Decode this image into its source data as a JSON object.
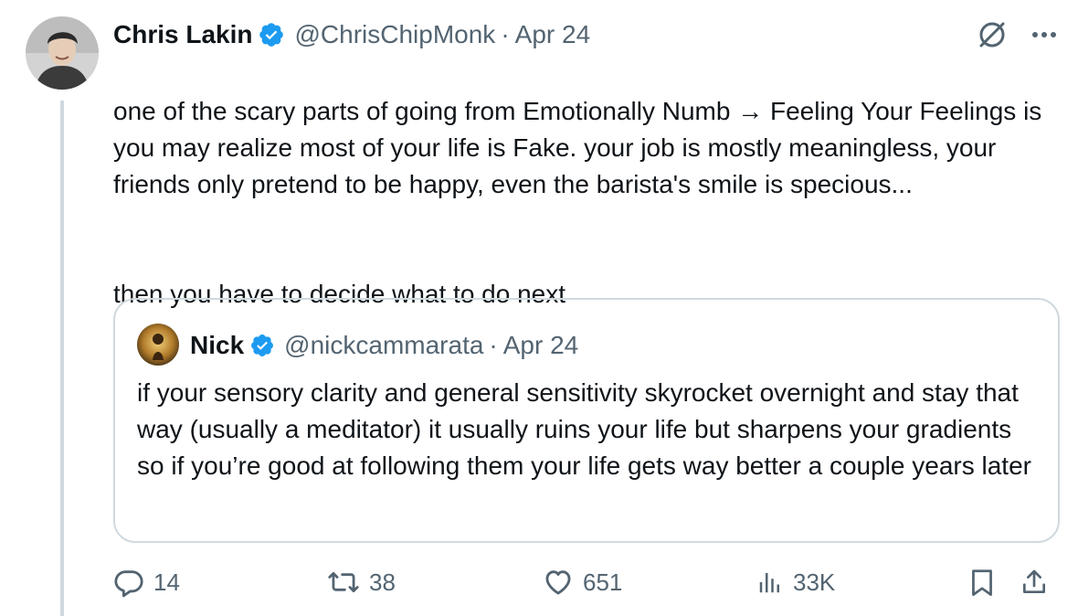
{
  "author": {
    "name": "Chris Lakin",
    "handle": "@ChrisChipMonk",
    "separator": "·",
    "time": "Apr 24",
    "verified_icon": "verified-badge-icon"
  },
  "tweet": {
    "text_paragraph_1": "one of the scary parts of going from Emotionally Numb → Feeling Your Feelings is you may realize most of your life is Fake. your job is mostly meaningless, your friends only pretend to be happy, even the barista's smile is specious...",
    "text_paragraph_2": "then you have to decide what to do next"
  },
  "quoted": {
    "name": "Nick",
    "handle": "@nickcammarata",
    "separator": "·",
    "time": "Apr 24",
    "text": "if your sensory clarity and general sensitivity skyrocket overnight and stay that way (usually a meditator) it usually ruins your life but sharpens your gradients so if you’re good at following them your life gets way better a couple years later"
  },
  "actions": {
    "replies": "14",
    "reposts": "38",
    "likes": "651",
    "views": "33K"
  },
  "colors": {
    "text": "#0f1419",
    "muted": "#536471",
    "border": "#cfd9de",
    "verified": "#1d9bf0"
  }
}
